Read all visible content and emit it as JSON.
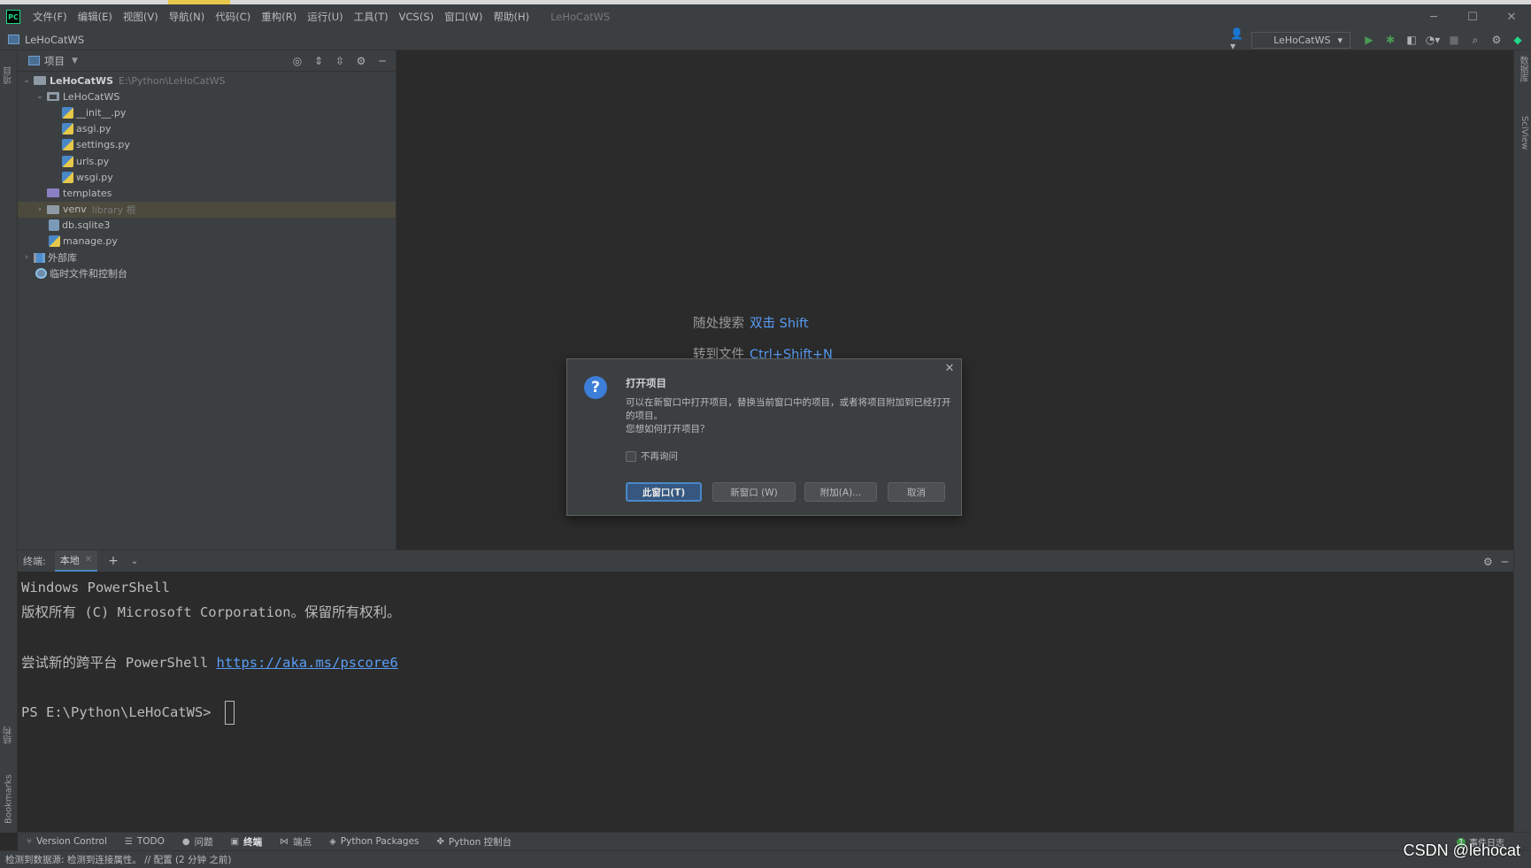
{
  "menubar": {
    "logo": "PC",
    "items": [
      "文件(F)",
      "编辑(E)",
      "视图(V)",
      "导航(N)",
      "代码(C)",
      "重构(R)",
      "运行(U)",
      "工具(T)",
      "VCS(S)",
      "窗口(W)",
      "帮助(H)"
    ],
    "title": "LeHoCatWS"
  },
  "navbar": {
    "project": "LeHoCatWS",
    "run_config": "LeHoCatWS"
  },
  "left_stripe": {
    "project": "项目",
    "structure": "结构",
    "bookmarks": "Bookmarks"
  },
  "right_stripe": {
    "database": "数据库",
    "sciview": "SciView"
  },
  "project_panel": {
    "title": "项目",
    "tree": [
      {
        "name": "LeHoCatWS",
        "path": "E:\\Python\\LeHoCatWS"
      },
      {
        "name": "LeHoCatWS"
      },
      {
        "name": "__init__.py"
      },
      {
        "name": "asgi.py"
      },
      {
        "name": "settings.py"
      },
      {
        "name": "urls.py"
      },
      {
        "name": "wsgi.py"
      },
      {
        "name": "templates"
      },
      {
        "name": "venv",
        "path": "library 根"
      },
      {
        "name": "db.sqlite3"
      },
      {
        "name": "manage.py"
      },
      {
        "name": "外部库"
      },
      {
        "name": "临时文件和控制台"
      }
    ]
  },
  "editor": {
    "hints": [
      {
        "label": "随处搜索",
        "key": "双击 Shift"
      },
      {
        "label": "转到文件",
        "key": "Ctrl+Shift+N"
      }
    ]
  },
  "dialog": {
    "title": "打开项目",
    "message": "可以在新窗口中打开项目，替换当前窗口中的项目，或者将项目附加到已经打开的项目。",
    "question": "您想如何打开项目？",
    "checkbox": "不再询问",
    "buttons": {
      "this_window": "此窗口(T)",
      "new_window": "新窗口 (W)",
      "attach": "附加(A)...",
      "cancel": "取消"
    }
  },
  "terminal": {
    "label": "终端:",
    "tab": "本地",
    "lines": [
      "Windows PowerShell",
      "版权所有 (C) Microsoft Corporation。保留所有权利。",
      "",
      "尝试新的跨平台 PowerShell "
    ],
    "link": "https://aka.ms/pscore6",
    "prompt": "PS E:\\Python\\LeHoCatWS> "
  },
  "bottom_tools": [
    "Version Control",
    "TODO",
    "问题",
    "终端",
    "端点",
    "Python Packages",
    "Python 控制台"
  ],
  "event_log": "事件日志",
  "status": {
    "text": "检测到数据源: 检测到连接属性。 // 配置 (2 分钟 之前)"
  },
  "watermark": "CSDN @lehocat"
}
